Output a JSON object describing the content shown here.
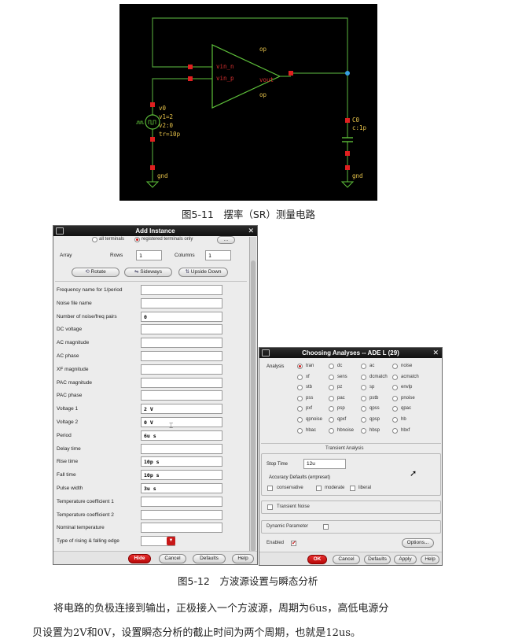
{
  "schematic": {
    "labels": {
      "op_top": "op",
      "op_bottom": "op",
      "vin_n": "vin_n",
      "vin_p": "vin_p",
      "vout": "vout",
      "v_inst": "v0",
      "v1": "v1=2",
      "v2": "v2:0",
      "tr": "tr=10p",
      "c_inst": "C0",
      "c_val": "c:1p",
      "gnd_left": "gnd",
      "gnd_right": "gnd"
    },
    "colors": {
      "background": "#000000",
      "wire": "#4e9a36",
      "pin": "#e02020",
      "instance": "#5ec03a",
      "label": "#e8c44a",
      "net_label": "#d83030",
      "junction": "#36a0e0"
    }
  },
  "caption1": "图5-11　摆率（SR）测量电路",
  "add_instance": {
    "title": "Add Instance",
    "terminals_all": "all terminals",
    "terminals_registered": "registered terminals only",
    "array": "Array",
    "rows_label": "Rows",
    "rows": "1",
    "columns_label": "Columns",
    "columns": "1",
    "rotate": "Rotate",
    "sideways": "Sideways",
    "upside_down": "Upside Down",
    "fields": [
      {
        "label": "Frequency name for 1/period",
        "value": ""
      },
      {
        "label": "Noise file name",
        "value": ""
      },
      {
        "label": "Number of noise/freq pairs",
        "value": "0"
      },
      {
        "label": "DC voltage",
        "value": ""
      },
      {
        "label": "AC magnitude",
        "value": ""
      },
      {
        "label": "AC phase",
        "value": ""
      },
      {
        "label": "XF magnitude",
        "value": ""
      },
      {
        "label": "PAC magnitude",
        "value": ""
      },
      {
        "label": "PAC phase",
        "value": ""
      },
      {
        "label": "Voltage 1",
        "value": "2 V"
      },
      {
        "label": "Voltage 2",
        "value": "0 V"
      },
      {
        "label": "Period",
        "value": "6u s"
      },
      {
        "label": "Delay time",
        "value": ""
      },
      {
        "label": "Rise time",
        "value": "10p s"
      },
      {
        "label": "Fall time",
        "value": "10p s"
      },
      {
        "label": "Pulse width",
        "value": "3u s"
      },
      {
        "label": "Temperature coefficient 1",
        "value": ""
      },
      {
        "label": "Temperature coefficient 2",
        "value": ""
      },
      {
        "label": "Nominal temperature",
        "value": ""
      },
      {
        "label": "Type of rising & falling edge",
        "value": ""
      }
    ],
    "buttons": {
      "hide": "Hide",
      "cancel": "Cancel",
      "defaults": "Defaults",
      "help": "Help"
    }
  },
  "choosing": {
    "title": "Choosing Analyses -- ADE L (29)",
    "analysis_label": "Analysis",
    "analyses": [
      "tran",
      "dc",
      "ac",
      "noise",
      "xf",
      "sens",
      "dcmatch",
      "acmatch",
      "stb",
      "pz",
      "sp",
      "envlp",
      "pss",
      "pac",
      "pstb",
      "pnoise",
      "pxf",
      "psp",
      "qpss",
      "qpac",
      "qpnoise",
      "qpxf",
      "qpsp",
      "hb",
      "hbac",
      "hbnoise",
      "hbsp",
      "hbxf"
    ],
    "section": "Transient Analysis",
    "stop_time_label": "Stop Time",
    "stop_time": "12u",
    "accuracy_label": "Accuracy Defaults (errpreset)",
    "accuracy_options": [
      "conservative",
      "moderate",
      "liberal"
    ],
    "transient_noise": "Transient Noise",
    "dynamic_parameter": "Dynamic Parameter",
    "enabled": "Enabled",
    "options": "Options...",
    "buttons": {
      "ok": "OK",
      "cancel": "Cancel",
      "defaults": "Defaults",
      "apply": "Apply",
      "help": "Help"
    }
  },
  "caption2": "图5-12　方波源设置与瞬态分析",
  "paragraph": [
    "将电路的负极连接到输出，正极接入一个方波源，周期为6us，高低电源分",
    "贝设置为2V和0V，设置瞬态分析的截止时间为两个周期，也就是12us。"
  ]
}
